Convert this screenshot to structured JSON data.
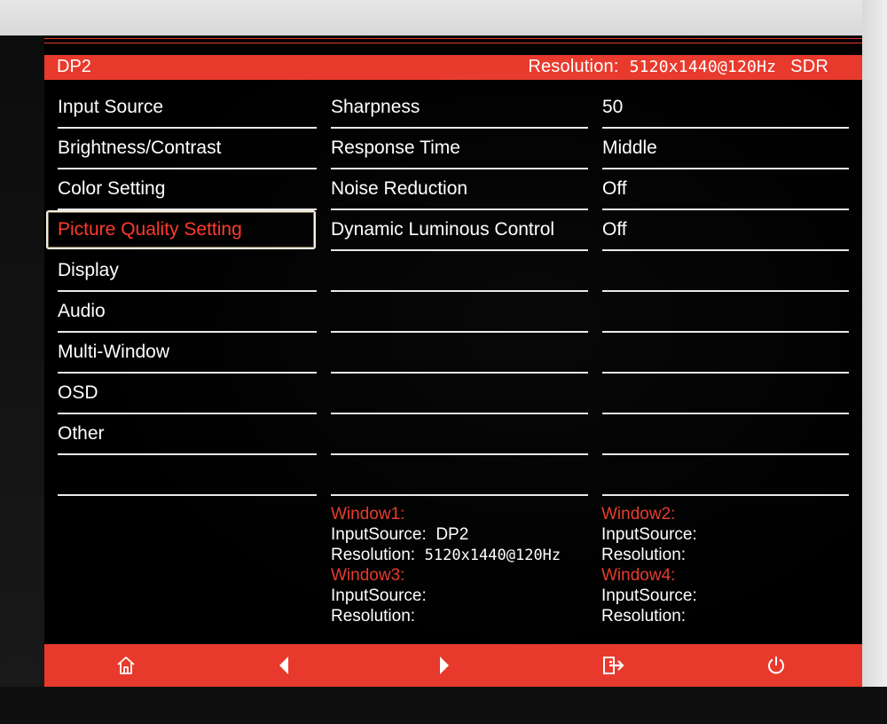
{
  "header": {
    "source": "DP2",
    "resolution_label": "Resolution:",
    "resolution_value": "5120x1440@120Hz",
    "dynamic_range": "SDR"
  },
  "menu": {
    "items": [
      {
        "label": "Input Source"
      },
      {
        "label": "Brightness/Contrast"
      },
      {
        "label": "Color Setting"
      },
      {
        "label": "Picture Quality Setting",
        "selected": true
      },
      {
        "label": "Display"
      },
      {
        "label": "Audio"
      },
      {
        "label": "Multi-Window"
      },
      {
        "label": "OSD"
      },
      {
        "label": "Other"
      },
      {
        "label": ""
      }
    ]
  },
  "settings": {
    "rows": [
      {
        "name": "Sharpness",
        "value": "50"
      },
      {
        "name": "Response Time",
        "value": "Middle"
      },
      {
        "name": "Noise Reduction",
        "value": "Off"
      },
      {
        "name": "Dynamic Luminous Control",
        "value": "Off"
      },
      {
        "name": "",
        "value": ""
      },
      {
        "name": "",
        "value": ""
      },
      {
        "name": "",
        "value": ""
      },
      {
        "name": "",
        "value": ""
      },
      {
        "name": "",
        "value": ""
      },
      {
        "name": "",
        "value": ""
      }
    ]
  },
  "windows": {
    "w1": {
      "title": "Window1:",
      "input_label": "InputSource:",
      "input_value": "DP2",
      "res_label": "Resolution:",
      "res_value": "5120x1440@120Hz"
    },
    "w2": {
      "title": "Window2:",
      "input_label": "InputSource:",
      "input_value": "",
      "res_label": "Resolution:",
      "res_value": ""
    },
    "w3": {
      "title": "Window3:",
      "input_label": "InputSource:",
      "input_value": "",
      "res_label": "Resolution:",
      "res_value": ""
    },
    "w4": {
      "title": "Window4:",
      "input_label": "InputSource:",
      "input_value": "",
      "res_label": "Resolution:",
      "res_value": ""
    }
  },
  "footer": {
    "buttons": [
      "home-icon",
      "left-arrow-icon",
      "right-arrow-icon",
      "exit-icon",
      "power-icon"
    ]
  },
  "colors": {
    "accent": "#e83a2c",
    "background": "#000000",
    "text": "#ffffff",
    "divider": "#e9e9e9"
  }
}
